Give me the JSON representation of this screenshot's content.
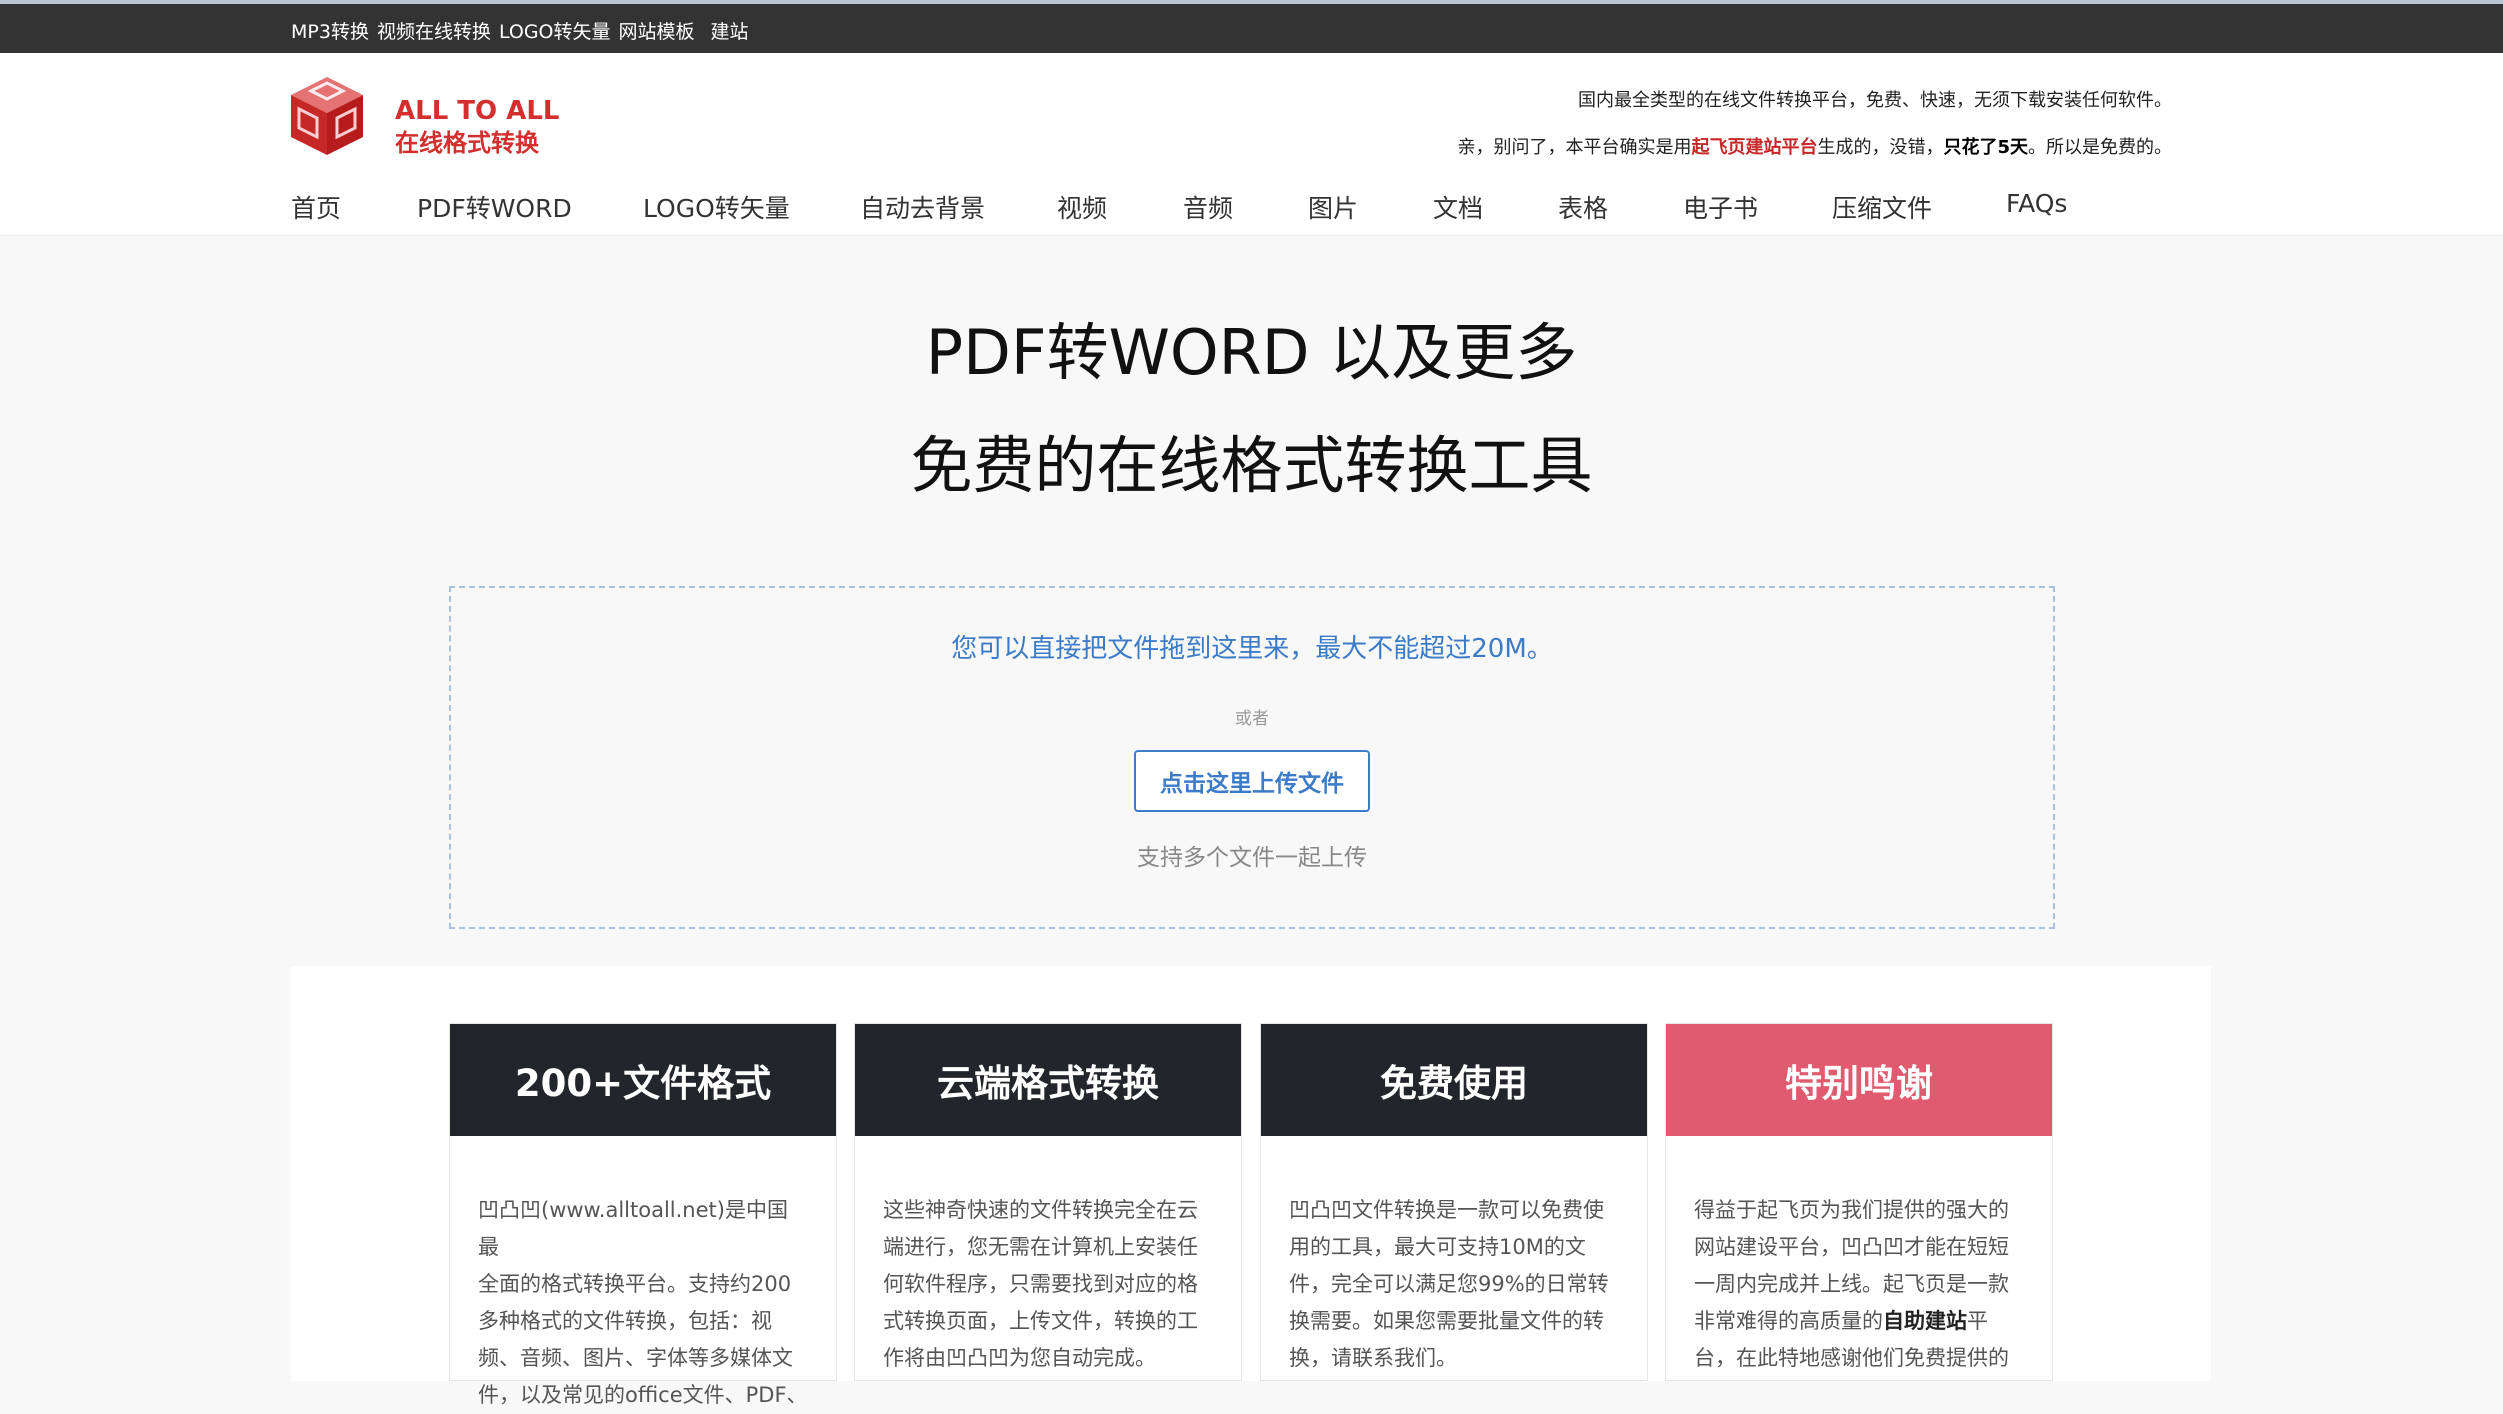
{
  "topbar": {
    "links": [
      "MP3转换",
      "视频在线转换",
      "LOGO转矢量",
      "网站模板",
      "建站"
    ]
  },
  "header": {
    "brand_en": "ALL TO ALL",
    "brand_cn": "在线格式转换",
    "slogan1": "国内最全类型的在线文件转换平台，免费、快速，无须下载安装任何软件。",
    "slogan2_prefix": "亲，别问了，本平台确实是用",
    "slogan2_highlight": "起飞页建站平台",
    "slogan2_mid": "生成的，没错，",
    "slogan2_bold": "只花了5天",
    "slogan2_suffix": "。所以是免费的。"
  },
  "nav": {
    "items": [
      "首页",
      "PDF转WORD",
      "LOGO转矢量",
      "自动去背景",
      "视频",
      "音频",
      "图片",
      "文档",
      "表格",
      "电子书",
      "压缩文件",
      "FAQs"
    ]
  },
  "hero": {
    "title1": "PDF转WORD 以及更多",
    "title2": "免费的在线格式转换工具"
  },
  "upload": {
    "hint": "您可以直接把文件拖到这里来，最大不能超过20M。",
    "or": "或者",
    "button": "点击这里上传文件",
    "multi": "支持多个文件一起上传"
  },
  "features": [
    {
      "title": "200+文件格式",
      "lines": [
        "凹凸凹(www.alltoall.net)是中国最",
        "全面的格式转换平台。支持约200",
        "多种格式的文件转换，包括：视",
        "频、音频、图片、字体等多媒体文",
        "件，以及常见的office文件、PDF、"
      ]
    },
    {
      "title": "云端格式转换",
      "lines": [
        "这些神奇快速的文件转换完全在云",
        "端进行，您无需在计算机上安装任",
        "何软件程序，只需要找到对应的格",
        "式转换页面，上传文件，转换的工",
        "作将由凹凸凹为您自动完成。"
      ]
    },
    {
      "title": "免费使用",
      "lines": [
        "凹凸凹文件转换是一款可以免费使",
        "用的工具，最大可支持10M的文",
        "件，完全可以满足您99%的日常转",
        "换需要。如果您需要批量文件的转",
        "换，请联系我们。"
      ]
    },
    {
      "title": "特别鸣谢",
      "line1": "得益于起飞页为我们提供的强大的",
      "line2": "网站建设平台，凹凸凹才能在短短",
      "line3": "一周内完成并上线。起飞页是一款",
      "line4_prefix": "非常难得的高质量的",
      "line4_bold": "自助建站",
      "line4_suffix": "平",
      "line5": "台，在此特地感谢他们免费提供的"
    }
  ],
  "colors": {
    "topbar_bg": "#333333",
    "brand_red": "#d32f2f",
    "link_blue": "#3b7bc8",
    "card_dark": "#23252c",
    "card_pink": "#e05b6f"
  }
}
